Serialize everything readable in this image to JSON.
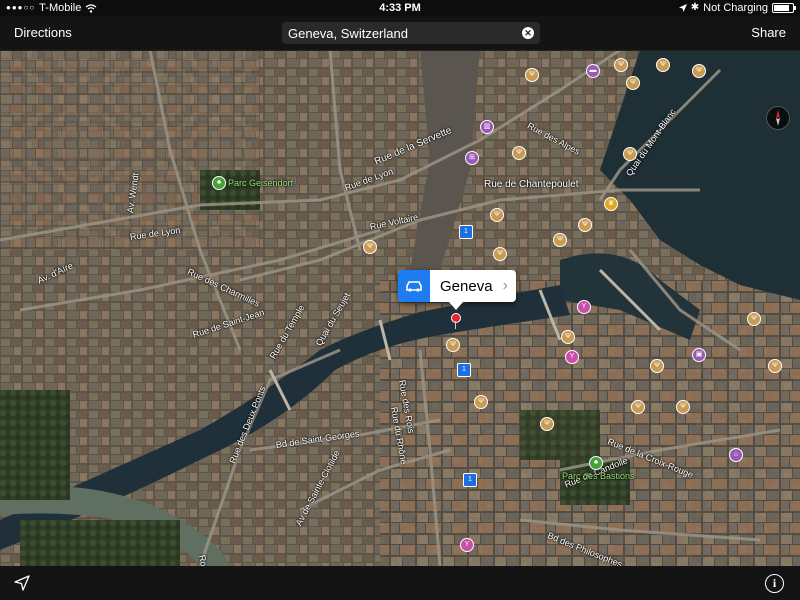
{
  "status_bar": {
    "carrier": "T-Mobile",
    "time": "4:33 PM",
    "battery_text": "Not Charging",
    "battery_level": 0.85
  },
  "nav": {
    "left_button": "Directions",
    "right_button": "Share",
    "search_value": "Geneva, Switzerland",
    "clear_icon": "close-circle-icon"
  },
  "callout": {
    "title": "Geneva",
    "left_icon": "car-icon",
    "accessory_icon": "chevron-right-icon",
    "accent_color": "#1e7cf0"
  },
  "map": {
    "style": "satellite",
    "street_labels": [
      "Rue de la Servette",
      "Rue de Lyon",
      "Rue de Chantepoulet",
      "Rue des Alpes",
      "Quai du Mont-Blanc",
      "Rue Voltaire",
      "Rue de Lyon",
      "Av. Wendt",
      "Av. d'Aïre",
      "Rue des Charmilles",
      "Rue de Saint-Jean",
      "Rue du Temple",
      "Quai du Seujet",
      "Rue du Rhône",
      "Rue des Rois",
      "Bd de Saint-Georges",
      "Rue des Deux Ponts",
      "Av de Sainte-Clotilde",
      "Rue de la Croix-Rouge",
      "Rue de Candolle",
      "Bd des Philosophes",
      "Route des Acacias"
    ],
    "park_labels": [
      "Parc Geisendorf",
      "Parc des Bastions"
    ]
  },
  "bottom": {
    "location_icon": "location-arrow-icon",
    "info_label": "i"
  }
}
